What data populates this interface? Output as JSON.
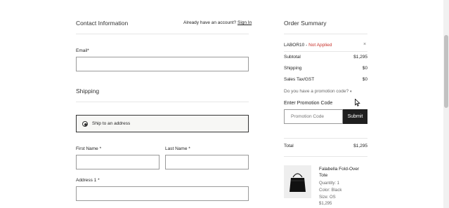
{
  "contact": {
    "title": "Contact Information",
    "have_account": "Already have an account?",
    "sign_in": "Sign In",
    "email_label": "Email*"
  },
  "shipping": {
    "title": "Shipping",
    "option": "Ship to an address",
    "first_name_label": "First Name *",
    "last_name_label": "Last Name *",
    "address1_label": "Address 1 *"
  },
  "summary": {
    "title": "Order Summary",
    "promo_code": "LABOR10",
    "promo_separator": " - ",
    "promo_status": "Not Applied",
    "promo_remove": "×",
    "subtotal_label": "Subtotal",
    "subtotal_value": "$1,295",
    "shipping_label": "Shipping",
    "shipping_value": "$0",
    "tax_label": "Sales Tax/GST",
    "tax_value": "$0",
    "promo_question": "Do you have a promotion code?",
    "enter_promo_label": "Enter Promotion Code",
    "promo_placeholder": "Promotion Code",
    "submit_label": "Submit",
    "total_label": "Total",
    "total_value": "$1,295",
    "item": {
      "name": "Falabella Fold-Over Tote",
      "quantity": "Quantity: 1",
      "color": "Color: Black",
      "size": "Size: OS",
      "price": "$1,295"
    }
  },
  "colors": {
    "accent_red": "#c8302a",
    "dark_button": "#1f1f1f"
  }
}
